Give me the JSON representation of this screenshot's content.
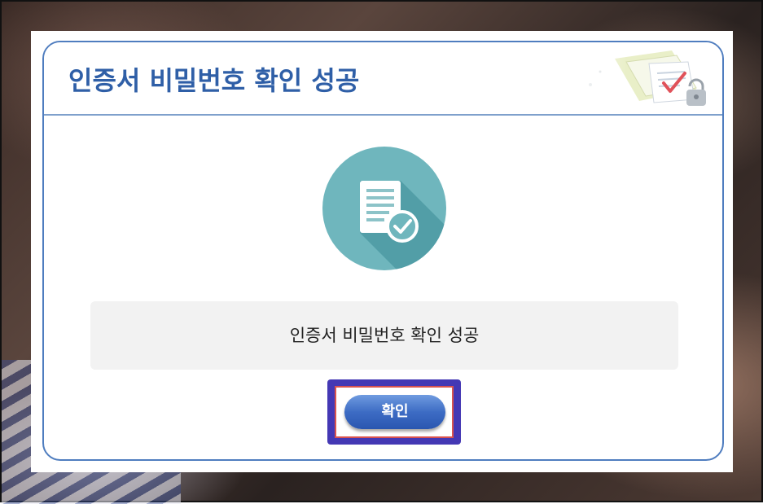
{
  "dialog": {
    "title": "인증서 비밀번호 확인 성공",
    "message": "인증서 비밀번호 확인 성공",
    "confirm_label": "확인"
  },
  "icons": {
    "header_art": "certificate-lock-illustration-icon",
    "status": "document-check-icon"
  },
  "colors": {
    "accent": "#2f5fa7",
    "border": "#4f7dbf",
    "icon_circle": "#6fb6bd",
    "highlight": "#4438b4",
    "highlight_inner": "#d9534f"
  }
}
